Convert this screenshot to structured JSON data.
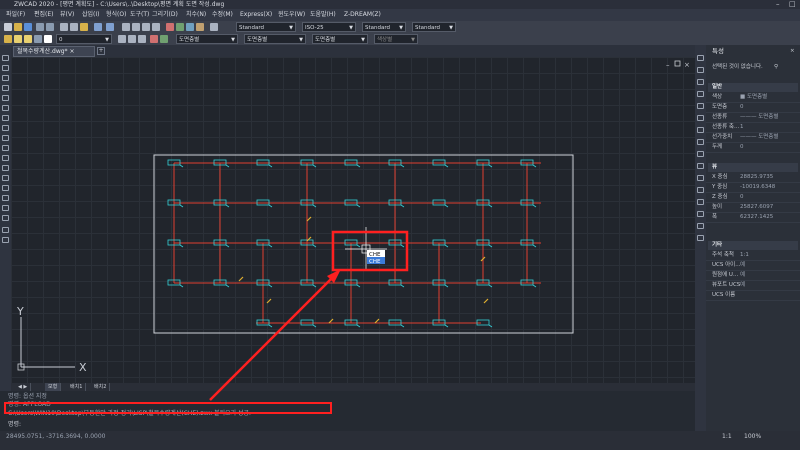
{
  "window": {
    "title": "ZWCAD 2020 - [평면 계획도] - C:\\Users\\..\\Desktop\\평면 계획 도면 작성.dwg"
  },
  "menu": [
    "파일(F)",
    "편집(E)",
    "뷰(V)",
    "삽입(I)",
    "형식(O)",
    "도구(T)",
    "그리기(D)",
    "치수(N)",
    "수정(M)",
    "Express(X)",
    "윈도우(W)",
    "도움말(H)",
    "Z-DREAM(Z)"
  ],
  "toolbar": {
    "text_style": "Standard",
    "dim_style": "ISO-25",
    "table_style": "Standard",
    "mleader_style": "Standard",
    "layer": "0",
    "color": "도면층별",
    "linetype": "도면층별",
    "lineweight": "도면층별",
    "plotstyle": "색상별"
  },
  "document": {
    "tab_label": "철복수량계산.dwg*"
  },
  "canvas": {
    "cursor_prompt_top": "CHE",
    "cursor_prompt_suggest": "CHE",
    "ucs_x": "X",
    "ucs_y": "Y"
  },
  "layout_tabs": [
    "모형",
    "배치1",
    "배치2"
  ],
  "command": {
    "line1": "명령: 옵션 지정",
    "line2": "명령: APPLOAD",
    "line3": "C:\\Users\\WIN10\\Desktop\\부동한만 과정 정리\\LISP\\철복수량계산(CHE).zwx 불러오기 성공.",
    "prompt": "명령:"
  },
  "status": {
    "coords": "28495.0751, -3716.3694, 0.0000",
    "scale": "1:1",
    "zoom": "100%"
  },
  "properties": {
    "title": "특성",
    "selection": "선택된 것이 없습니다.",
    "general_header": "일반",
    "general": [
      {
        "k": "색상",
        "v": "■ 도면층별"
      },
      {
        "k": "도면층",
        "v": "0"
      },
      {
        "k": "선종류",
        "v": "——— 도면층별"
      },
      {
        "k": "선종류 축...",
        "v": "1"
      },
      {
        "k": "선가중치",
        "v": "——— 도면층별"
      },
      {
        "k": "두께",
        "v": "0"
      }
    ],
    "view_header": "뷰",
    "view": [
      {
        "k": "X 중심",
        "v": "28825.9735"
      },
      {
        "k": "Y 중심",
        "v": "-10019.6348"
      },
      {
        "k": "Z 중심",
        "v": "0"
      },
      {
        "k": "높이",
        "v": "25827.6097"
      },
      {
        "k": "폭",
        "v": "62327.1425"
      }
    ],
    "misc_header": "기타",
    "misc": [
      {
        "k": "주석 축척",
        "v": "1:1"
      },
      {
        "k": "UCS 아이...",
        "v": "예"
      },
      {
        "k": "원점에 U...",
        "v": "예"
      },
      {
        "k": "뷰포트 UCS",
        "v": "예"
      },
      {
        "k": "UCS 이름",
        "v": ""
      }
    ]
  },
  "colors": {
    "highlight": "#ff2020",
    "cyan": "#35d0d8",
    "grid": "#2b3038"
  }
}
